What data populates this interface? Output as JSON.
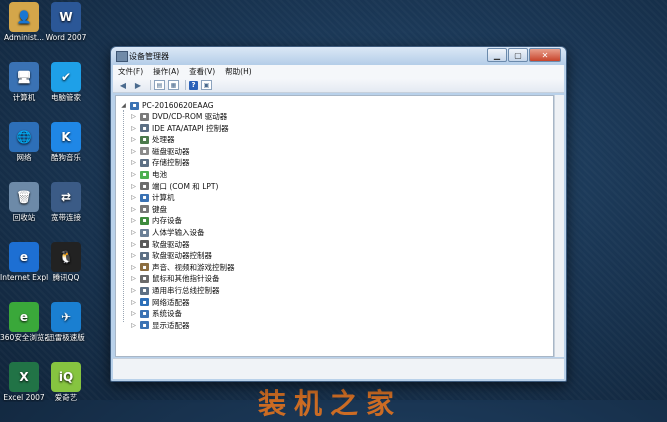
{
  "desktop": {
    "icons": [
      {
        "label": "Administ...",
        "name": "administrator-icon",
        "color": "#d4a64a",
        "glyph": "👤"
      },
      {
        "label": "Word 2007",
        "name": "word-icon",
        "color": "#2b5797",
        "glyph": "W"
      },
      {
        "label": "计算机",
        "name": "computer-icon",
        "color": "#3a72b4",
        "glyph": "🖥"
      },
      {
        "label": "电脑管家",
        "name": "pc-manager-icon",
        "color": "#1ea0e8",
        "glyph": "✔"
      },
      {
        "label": "网络",
        "name": "network-icon",
        "color": "#2d6fb8",
        "glyph": "🌐"
      },
      {
        "label": "酷狗音乐",
        "name": "kugou-icon",
        "color": "#1f87e6",
        "glyph": "K"
      },
      {
        "label": "回收站",
        "name": "recycle-bin-icon",
        "color": "#6d8aa8",
        "glyph": "🗑"
      },
      {
        "label": "宽带连接",
        "name": "broadband-icon",
        "color": "#3b5b86",
        "glyph": "⇄"
      },
      {
        "label": "Internet Explorer",
        "name": "ie-icon",
        "color": "#1d6fd3",
        "glyph": "e"
      },
      {
        "label": "腾讯QQ",
        "name": "qq-icon",
        "color": "#222222",
        "glyph": "🐧"
      },
      {
        "label": "360安全浏览器",
        "name": "360-browser-icon",
        "color": "#3aa83a",
        "glyph": "e"
      },
      {
        "label": "迅雷极速版",
        "name": "xunlei-icon",
        "color": "#1a7fd1",
        "glyph": "✈"
      },
      {
        "label": "Excel 2007",
        "name": "excel-icon",
        "color": "#217346",
        "glyph": "X"
      },
      {
        "label": "爱奇艺",
        "name": "iqiyi-icon",
        "color": "#86c440",
        "glyph": "iQ"
      }
    ]
  },
  "watermark": "装机之家",
  "window": {
    "title": "设备管理器",
    "menu": [
      "文件(F)",
      "操作(A)",
      "查看(V)",
      "帮助(H)"
    ],
    "root": "PC-20160620EAAG",
    "devices": [
      {
        "label": "DVD/CD-ROM 驱动器",
        "icon": "dvd-drive-icon",
        "color": "#7a7a7a"
      },
      {
        "label": "IDE ATA/ATAPI 控制器",
        "icon": "ide-controller-icon",
        "color": "#5c6f84"
      },
      {
        "label": "处理器",
        "icon": "processor-icon",
        "color": "#4b7a4b"
      },
      {
        "label": "磁盘驱动器",
        "icon": "disk-drive-icon",
        "color": "#8a8a8a"
      },
      {
        "label": "存储控制器",
        "icon": "storage-controller-icon",
        "color": "#5c6f84"
      },
      {
        "label": "电池",
        "icon": "battery-icon",
        "color": "#4caf50"
      },
      {
        "label": "端口 (COM 和 LPT)",
        "icon": "port-icon",
        "color": "#6b6b6b"
      },
      {
        "label": "计算机",
        "icon": "computer-icon",
        "color": "#3a72b4"
      },
      {
        "label": "键盘",
        "icon": "keyboard-icon",
        "color": "#777777"
      },
      {
        "label": "内存设备",
        "icon": "memory-icon",
        "color": "#3d8b3d"
      },
      {
        "label": "人体学输入设备",
        "icon": "hid-icon",
        "color": "#6a7f96"
      },
      {
        "label": "软盘驱动器",
        "icon": "floppy-drive-icon",
        "color": "#5a5a5a"
      },
      {
        "label": "软盘驱动器控制器",
        "icon": "floppy-controller-icon",
        "color": "#5c6f84"
      },
      {
        "label": "声音、视频和游戏控制器",
        "icon": "sound-icon",
        "color": "#8c6d3f"
      },
      {
        "label": "鼠标和其他指针设备",
        "icon": "mouse-icon",
        "color": "#6b6b6b"
      },
      {
        "label": "通用串行总线控制器",
        "icon": "usb-icon",
        "color": "#5c6f84"
      },
      {
        "label": "网络适配器",
        "icon": "network-adapter-icon",
        "color": "#2d6fb8"
      },
      {
        "label": "系统设备",
        "icon": "system-device-icon",
        "color": "#3a72b4"
      },
      {
        "label": "显示适配器",
        "icon": "display-adapter-icon",
        "color": "#3a72b4"
      }
    ]
  }
}
